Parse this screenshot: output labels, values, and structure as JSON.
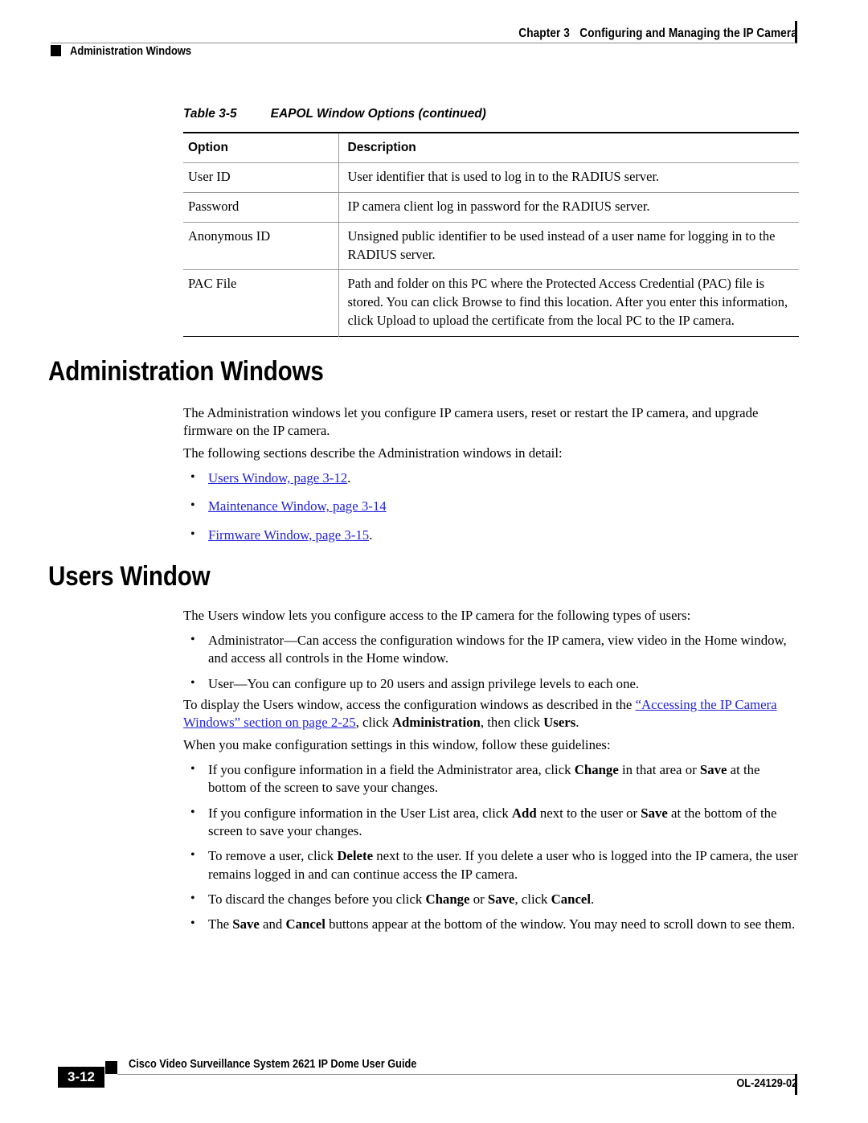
{
  "header": {
    "chapter_label": "Chapter 3",
    "chapter_title": "Configuring and Managing the IP Camera",
    "section_title": "Administration Windows"
  },
  "table": {
    "caption_label": "Table 3-5",
    "caption_title": "EAPOL Window Options (continued)",
    "columns": [
      "Option",
      "Description"
    ],
    "rows": [
      {
        "option": "User ID",
        "description": "User identifier that is used to log in to the RADIUS server."
      },
      {
        "option": "Password",
        "description": "IP camera client log in password for the RADIUS server."
      },
      {
        "option": "Anonymous ID",
        "description": "Unsigned public identifier to be used instead of a user name for logging in to the RADIUS server."
      },
      {
        "option": "PAC File",
        "description": "Path and folder on this PC where the Protected Access Credential (PAC) file is stored. You can click Browse to find this location. After you enter this information, click Upload to upload the certificate from the local PC to the IP camera."
      }
    ]
  },
  "sections": {
    "administration_windows": {
      "heading": "Administration Windows",
      "intro": "The Administration windows let you configure IP camera users, reset or restart the IP camera, and upgrade firmware on the IP camera.",
      "lead_in": "The following sections describe the Administration windows in detail:",
      "links": [
        {
          "text": "Users Window, page 3-12",
          "trailing": "."
        },
        {
          "text": "Maintenance Window, page 3-14",
          "trailing": ""
        },
        {
          "text": "Firmware Window, page 3-15",
          "trailing": "."
        }
      ]
    },
    "users_window": {
      "heading": "Users Window",
      "intro": "The Users window lets you configure access to the IP camera for the following types of users:",
      "user_types": [
        "Administrator—Can access the configuration windows for the IP camera, view video in the Home window, and access all controls in the Home window.",
        "User—You can configure up to 20 users and assign privilege levels to each one."
      ],
      "display_para": {
        "before_link": "To display the Users window, access the configuration windows as described in the ",
        "link_text": "“Accessing the IP Camera Windows” section on page 2-25",
        "after_link_1": ", click ",
        "bold_1": "Administration",
        "after_link_2": ", then click ",
        "bold_2": "Users",
        "after_link_3": "."
      },
      "guidelines_lead_in": "When you make configuration settings in this window, follow these guidelines:",
      "guidelines": [
        {
          "parts": [
            {
              "t": "If you configure information in a field the Administrator area, click ",
              "b": false
            },
            {
              "t": "Change",
              "b": true
            },
            {
              "t": " in that area or ",
              "b": false
            },
            {
              "t": "Save",
              "b": true
            },
            {
              "t": " at the bottom of the screen to save your changes.",
              "b": false
            }
          ]
        },
        {
          "parts": [
            {
              "t": "If you configure information in the User List area, click ",
              "b": false
            },
            {
              "t": "Add",
              "b": true
            },
            {
              "t": " next to the user or ",
              "b": false
            },
            {
              "t": "Save",
              "b": true
            },
            {
              "t": " at the bottom of the screen to save your changes.",
              "b": false
            }
          ]
        },
        {
          "parts": [
            {
              "t": "To remove a user, click ",
              "b": false
            },
            {
              "t": "Delete",
              "b": true
            },
            {
              "t": " next to the user. If you delete a user who is logged into the IP camera, the user remains logged in and can continue access the IP camera.",
              "b": false
            }
          ]
        },
        {
          "parts": [
            {
              "t": "To discard the changes before you click ",
              "b": false
            },
            {
              "t": "Change",
              "b": true
            },
            {
              "t": " or ",
              "b": false
            },
            {
              "t": "Save",
              "b": true
            },
            {
              "t": ", click ",
              "b": false
            },
            {
              "t": "Cancel",
              "b": true
            },
            {
              "t": ".",
              "b": false
            }
          ]
        },
        {
          "parts": [
            {
              "t": "The ",
              "b": false
            },
            {
              "t": "Save",
              "b": true
            },
            {
              "t": " and ",
              "b": false
            },
            {
              "t": "Cancel",
              "b": true
            },
            {
              "t": " buttons appear at the bottom of the window. You may need to scroll down to see them.",
              "b": false
            }
          ]
        }
      ]
    }
  },
  "footer": {
    "page_number": "3-12",
    "guide_title": "Cisco Video Surveillance System 2621 IP Dome User Guide",
    "doc_id": "OL-24129-02"
  },
  "colors": {
    "link": "#2222dd",
    "rule": "#8a8a8a",
    "text": "#000000"
  }
}
